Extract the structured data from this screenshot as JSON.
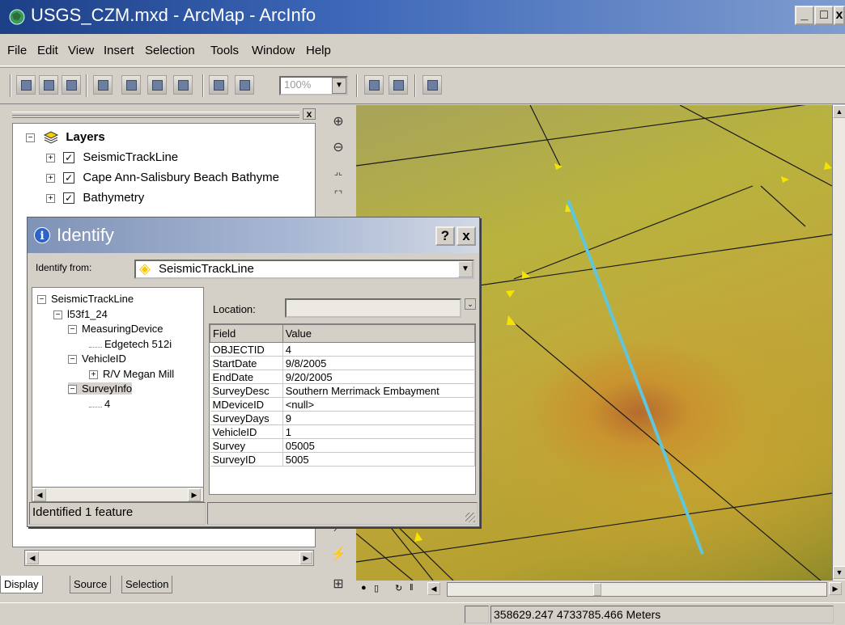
{
  "window": {
    "title": "USGS_CZM.mxd - ArcMap - ArcInfo",
    "buttons": {
      "minimize": "_",
      "maximize": "□",
      "close": "x"
    }
  },
  "menu": [
    {
      "label": "File"
    },
    {
      "label": "Edit"
    },
    {
      "label": "View"
    },
    {
      "label": "Insert"
    },
    {
      "label": "Selection"
    },
    {
      "label": "Tools"
    },
    {
      "label": "Window"
    },
    {
      "label": "Help"
    }
  ],
  "toolbar": {
    "zoom_value": "100%"
  },
  "toc": {
    "close": "x",
    "root_label": "Layers",
    "layers": [
      {
        "label": "SeismicTrackLine",
        "checked": true
      },
      {
        "label": "Cape Ann-Salisbury Beach Bathyme",
        "checked": true
      },
      {
        "label": "Bathymetry",
        "checked": true
      }
    ],
    "tabs": [
      {
        "label": "Display"
      },
      {
        "label": "Source"
      },
      {
        "label": "Selection"
      }
    ]
  },
  "identify": {
    "title": "Identify",
    "help": "?",
    "close": "x",
    "from_label": "Identify from:",
    "from_value": "SeismicTrackLine",
    "location_label": "Location:",
    "location_value": "",
    "tree": [
      {
        "label": "SeismicTrackLine",
        "level": 0,
        "pm": "−"
      },
      {
        "label": "l53f1_24",
        "level": 1,
        "pm": "−"
      },
      {
        "label": "MeasuringDevice",
        "level": 2,
        "pm": "−"
      },
      {
        "label": "Edgetech 512i",
        "level": 3,
        "pm": ""
      },
      {
        "label": "VehicleID",
        "level": 2,
        "pm": "−"
      },
      {
        "label": "R/V Megan Mill",
        "level": 3,
        "pm": "+"
      },
      {
        "label": "SurveyInfo",
        "level": 2,
        "pm": "−",
        "selected": true
      },
      {
        "label": "4",
        "level": 3,
        "pm": ""
      }
    ],
    "columns": {
      "field": "Field",
      "value": "Value"
    },
    "rows": [
      {
        "field": "OBJECTID",
        "value": "4"
      },
      {
        "field": "StartDate",
        "value": "9/8/2005"
      },
      {
        "field": "EndDate",
        "value": "9/20/2005"
      },
      {
        "field": "SurveyDesc",
        "value": "Southern Merrimack Embayment"
      },
      {
        "field": "MDeviceID",
        "value": "<null>"
      },
      {
        "field": "SurveyDays",
        "value": "9"
      },
      {
        "field": "VehicleID",
        "value": "1"
      },
      {
        "field": "Survey",
        "value": "05005"
      },
      {
        "field": "SurveyID",
        "value": "5005"
      }
    ],
    "status": "Identified 1 feature"
  },
  "statusbar": {
    "coordinates": "358629.247  4733785.466 Meters"
  },
  "colors": {
    "highlight_track": "#5fc6dc",
    "track_line": "#1a1a1a",
    "arrow": "#f6e400"
  }
}
